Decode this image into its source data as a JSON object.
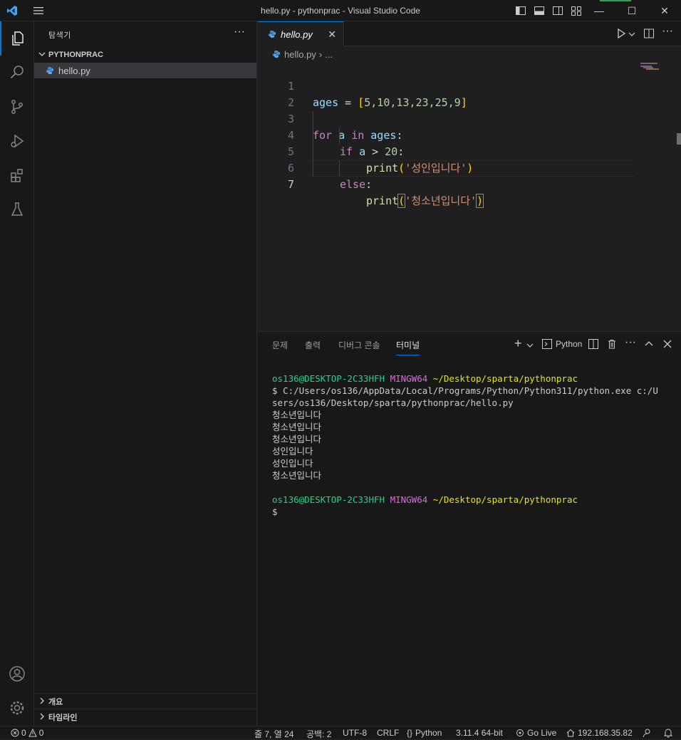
{
  "window": {
    "title": "hello.py - pythonprac - Visual Studio Code",
    "minimize": "—",
    "maximize": "☐",
    "close": "✕"
  },
  "sidebar": {
    "header": "탐색기",
    "more": "···",
    "folder": "PYTHONPRAC",
    "file": "hello.py",
    "outline": "개요",
    "timeline": "타임라인"
  },
  "editor": {
    "tab_label": "hello.py",
    "tab_close": "✕",
    "breadcrumb_file": "hello.py",
    "breadcrumb_sep": "›",
    "breadcrumb_more": "...",
    "lines": [
      {
        "n": "1"
      },
      {
        "n": "2"
      },
      {
        "n": "3"
      },
      {
        "n": "4"
      },
      {
        "n": "5"
      },
      {
        "n": "6"
      },
      {
        "n": "7"
      }
    ],
    "tokens": {
      "ages": "ages",
      "eq": " = ",
      "lb": "[",
      "list": "5,10,13,23,25,9",
      "rb": "]",
      "for": "for",
      "a": "a",
      "in": "in",
      "colon": ":",
      "if": "if",
      "gt": " > ",
      "twenty": "20",
      "print": "print",
      "lp": "(",
      "rp": ")",
      "str_adult": "'성인입니다'",
      "else": "else",
      "str_teen": "'청소년입니다'"
    }
  },
  "panel": {
    "tabs": [
      "문제",
      "출력",
      "디버그 콘솔",
      "터미널"
    ],
    "active_tab": "터미널",
    "add": "+",
    "shell_name": "Python",
    "more": "···",
    "terminal": {
      "prompt_user": "os136@DESKTOP-2C33HFH",
      "prompt_env": "MINGW64",
      "prompt_path": "~/Desktop/sparta/pythonprac",
      "command_line1": "$ C:/Users/os136/AppData/Local/Programs/Python/Python311/python.exe c:/U",
      "command_line2": "sers/os136/Desktop/sparta/pythonprac/hello.py",
      "output": [
        "청소년입니다",
        "청소년입니다",
        "청소년입니다",
        "성인입니다",
        "성인입니다",
        "청소년입니다"
      ],
      "cursor_prompt": "$"
    }
  },
  "statusbar": {
    "errors": "0",
    "warnings": "0",
    "position": "줄 7, 열 24",
    "spaces": "공백: 2",
    "encoding": "UTF-8",
    "eol": "CRLF",
    "language": "Python",
    "interpreter": "3.11.4 64-bit",
    "golive": "Go Live",
    "ip": "192.168.35.82"
  },
  "colors": {
    "accent": "#0078d4",
    "background": "#1f1f1f",
    "sidebar": "#181818"
  }
}
